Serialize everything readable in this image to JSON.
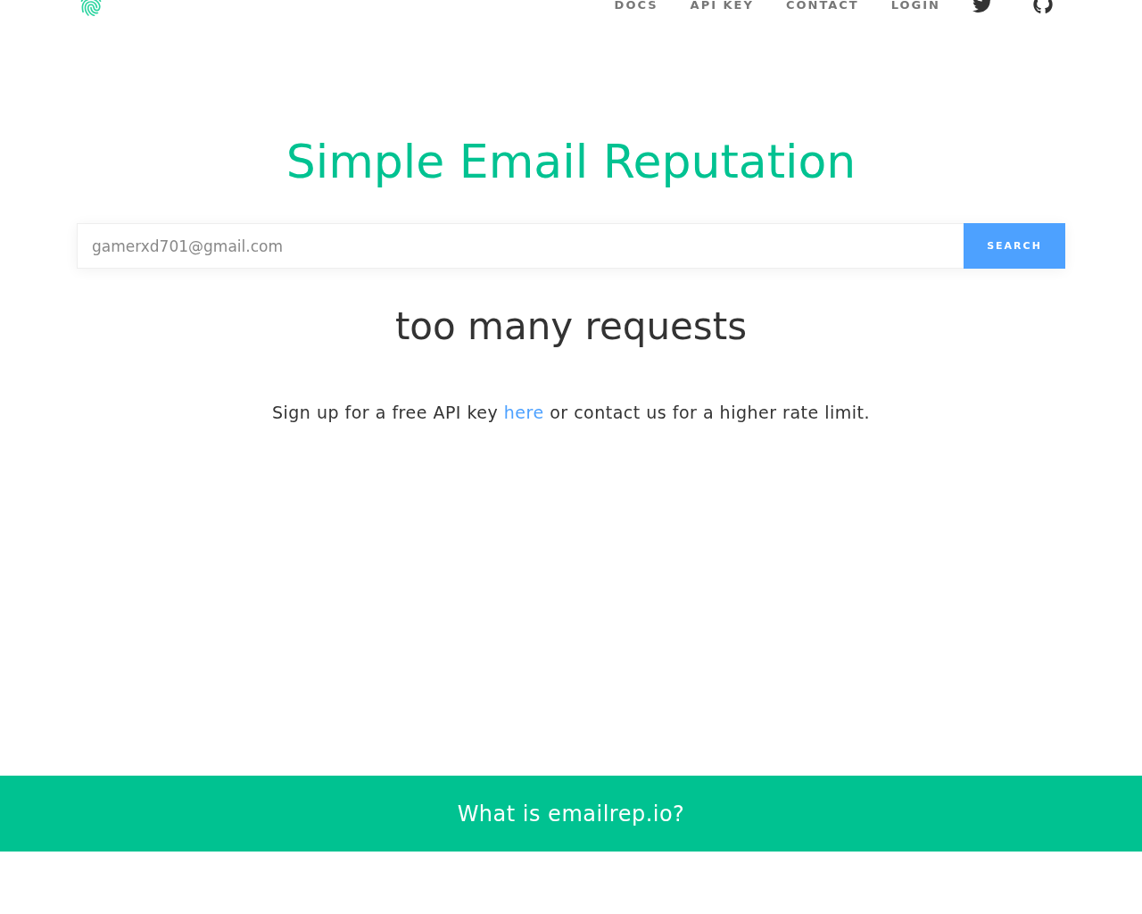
{
  "nav": {
    "links": [
      {
        "label": "DOCS"
      },
      {
        "label": "API KEY"
      },
      {
        "label": "CONTACT"
      },
      {
        "label": "LOGIN"
      }
    ]
  },
  "hero": {
    "title": "Simple Email Reputation",
    "search": {
      "value": "gamerxd701@gmail.com",
      "button": "SEARCH"
    },
    "result": "too many requests",
    "message": "Sign up for a free API key ",
    "link": "here",
    "message_end": " or contact us for a higher rate limit."
  },
  "footer_band": {
    "title": "What is emailrep.io?"
  }
}
